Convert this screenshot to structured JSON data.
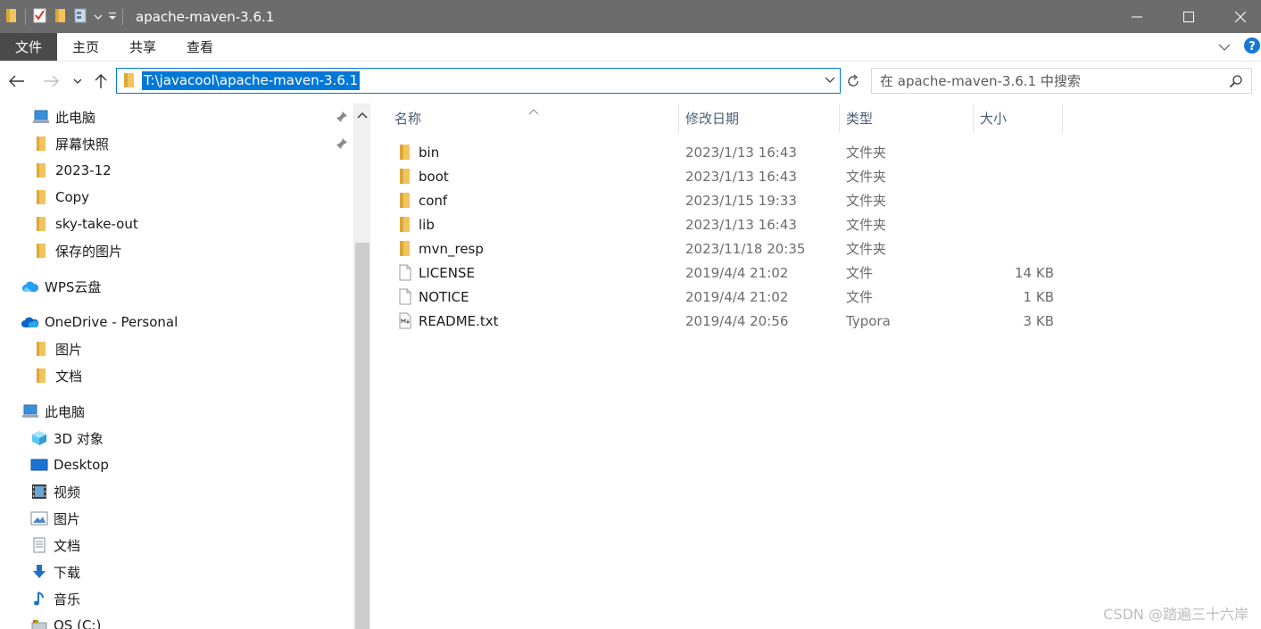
{
  "window": {
    "title": "apache-maven-3.6.1",
    "accent": "#0078d7"
  },
  "ribbon": {
    "tabs": [
      {
        "label": "文件"
      },
      {
        "label": "主页"
      },
      {
        "label": "共享"
      },
      {
        "label": "查看"
      }
    ]
  },
  "address": {
    "path": "T:\\javacool\\apache-maven-3.6.1",
    "search_placeholder": "在 apache-maven-3.6.1 中搜索"
  },
  "nav": {
    "items": [
      {
        "label": "此电脑",
        "icon": "pc-icon",
        "pinned": true
      },
      {
        "label": "屏幕快照",
        "icon": "folder-icon",
        "pinned": true
      },
      {
        "label": "2023-12",
        "icon": "folder-icon"
      },
      {
        "label": "Copy",
        "icon": "folder-icon"
      },
      {
        "label": "sky-take-out",
        "icon": "folder-icon"
      },
      {
        "label": "保存的图片",
        "icon": "folder-icon"
      },
      {
        "label": "WPS云盘",
        "icon": "wps-cloud-icon"
      },
      {
        "label": "OneDrive - Personal",
        "icon": "onedrive-icon"
      },
      {
        "label": "图片",
        "icon": "folder-icon"
      },
      {
        "label": "文档",
        "icon": "folder-icon"
      },
      {
        "label": "此电脑",
        "icon": "pc-icon"
      },
      {
        "label": "3D 对象",
        "icon": "3d-objects-icon"
      },
      {
        "label": "Desktop",
        "icon": "desktop-icon"
      },
      {
        "label": "视频",
        "icon": "video-icon"
      },
      {
        "label": "图片",
        "icon": "pictures-icon"
      },
      {
        "label": "文档",
        "icon": "documents-icon"
      },
      {
        "label": "下载",
        "icon": "download-icon"
      },
      {
        "label": "音乐",
        "icon": "music-icon"
      },
      {
        "label": "OS (C:)",
        "icon": "drive-icon"
      }
    ]
  },
  "files": {
    "columns": [
      "名称",
      "修改日期",
      "类型",
      "大小"
    ],
    "rows": [
      {
        "name": "bin",
        "date": "2023/1/13 16:43",
        "type": "文件夹",
        "size": "",
        "icon": "folder-icon"
      },
      {
        "name": "boot",
        "date": "2023/1/13 16:43",
        "type": "文件夹",
        "size": "",
        "icon": "folder-icon"
      },
      {
        "name": "conf",
        "date": "2023/1/15 19:33",
        "type": "文件夹",
        "size": "",
        "icon": "folder-icon"
      },
      {
        "name": "lib",
        "date": "2023/1/13 16:43",
        "type": "文件夹",
        "size": "",
        "icon": "folder-icon"
      },
      {
        "name": "mvn_resp",
        "date": "2023/11/18 20:35",
        "type": "文件夹",
        "size": "",
        "icon": "folder-icon"
      },
      {
        "name": "LICENSE",
        "date": "2019/4/4 21:02",
        "type": "文件",
        "size": "14 KB",
        "icon": "file-icon"
      },
      {
        "name": "NOTICE",
        "date": "2019/4/4 21:02",
        "type": "文件",
        "size": "1 KB",
        "icon": "file-icon"
      },
      {
        "name": "README.txt",
        "date": "2019/4/4 20:56",
        "type": "Typora",
        "size": "3 KB",
        "icon": "markdown-file-icon"
      }
    ]
  },
  "watermark": "CSDN @踏遍三十六岸"
}
